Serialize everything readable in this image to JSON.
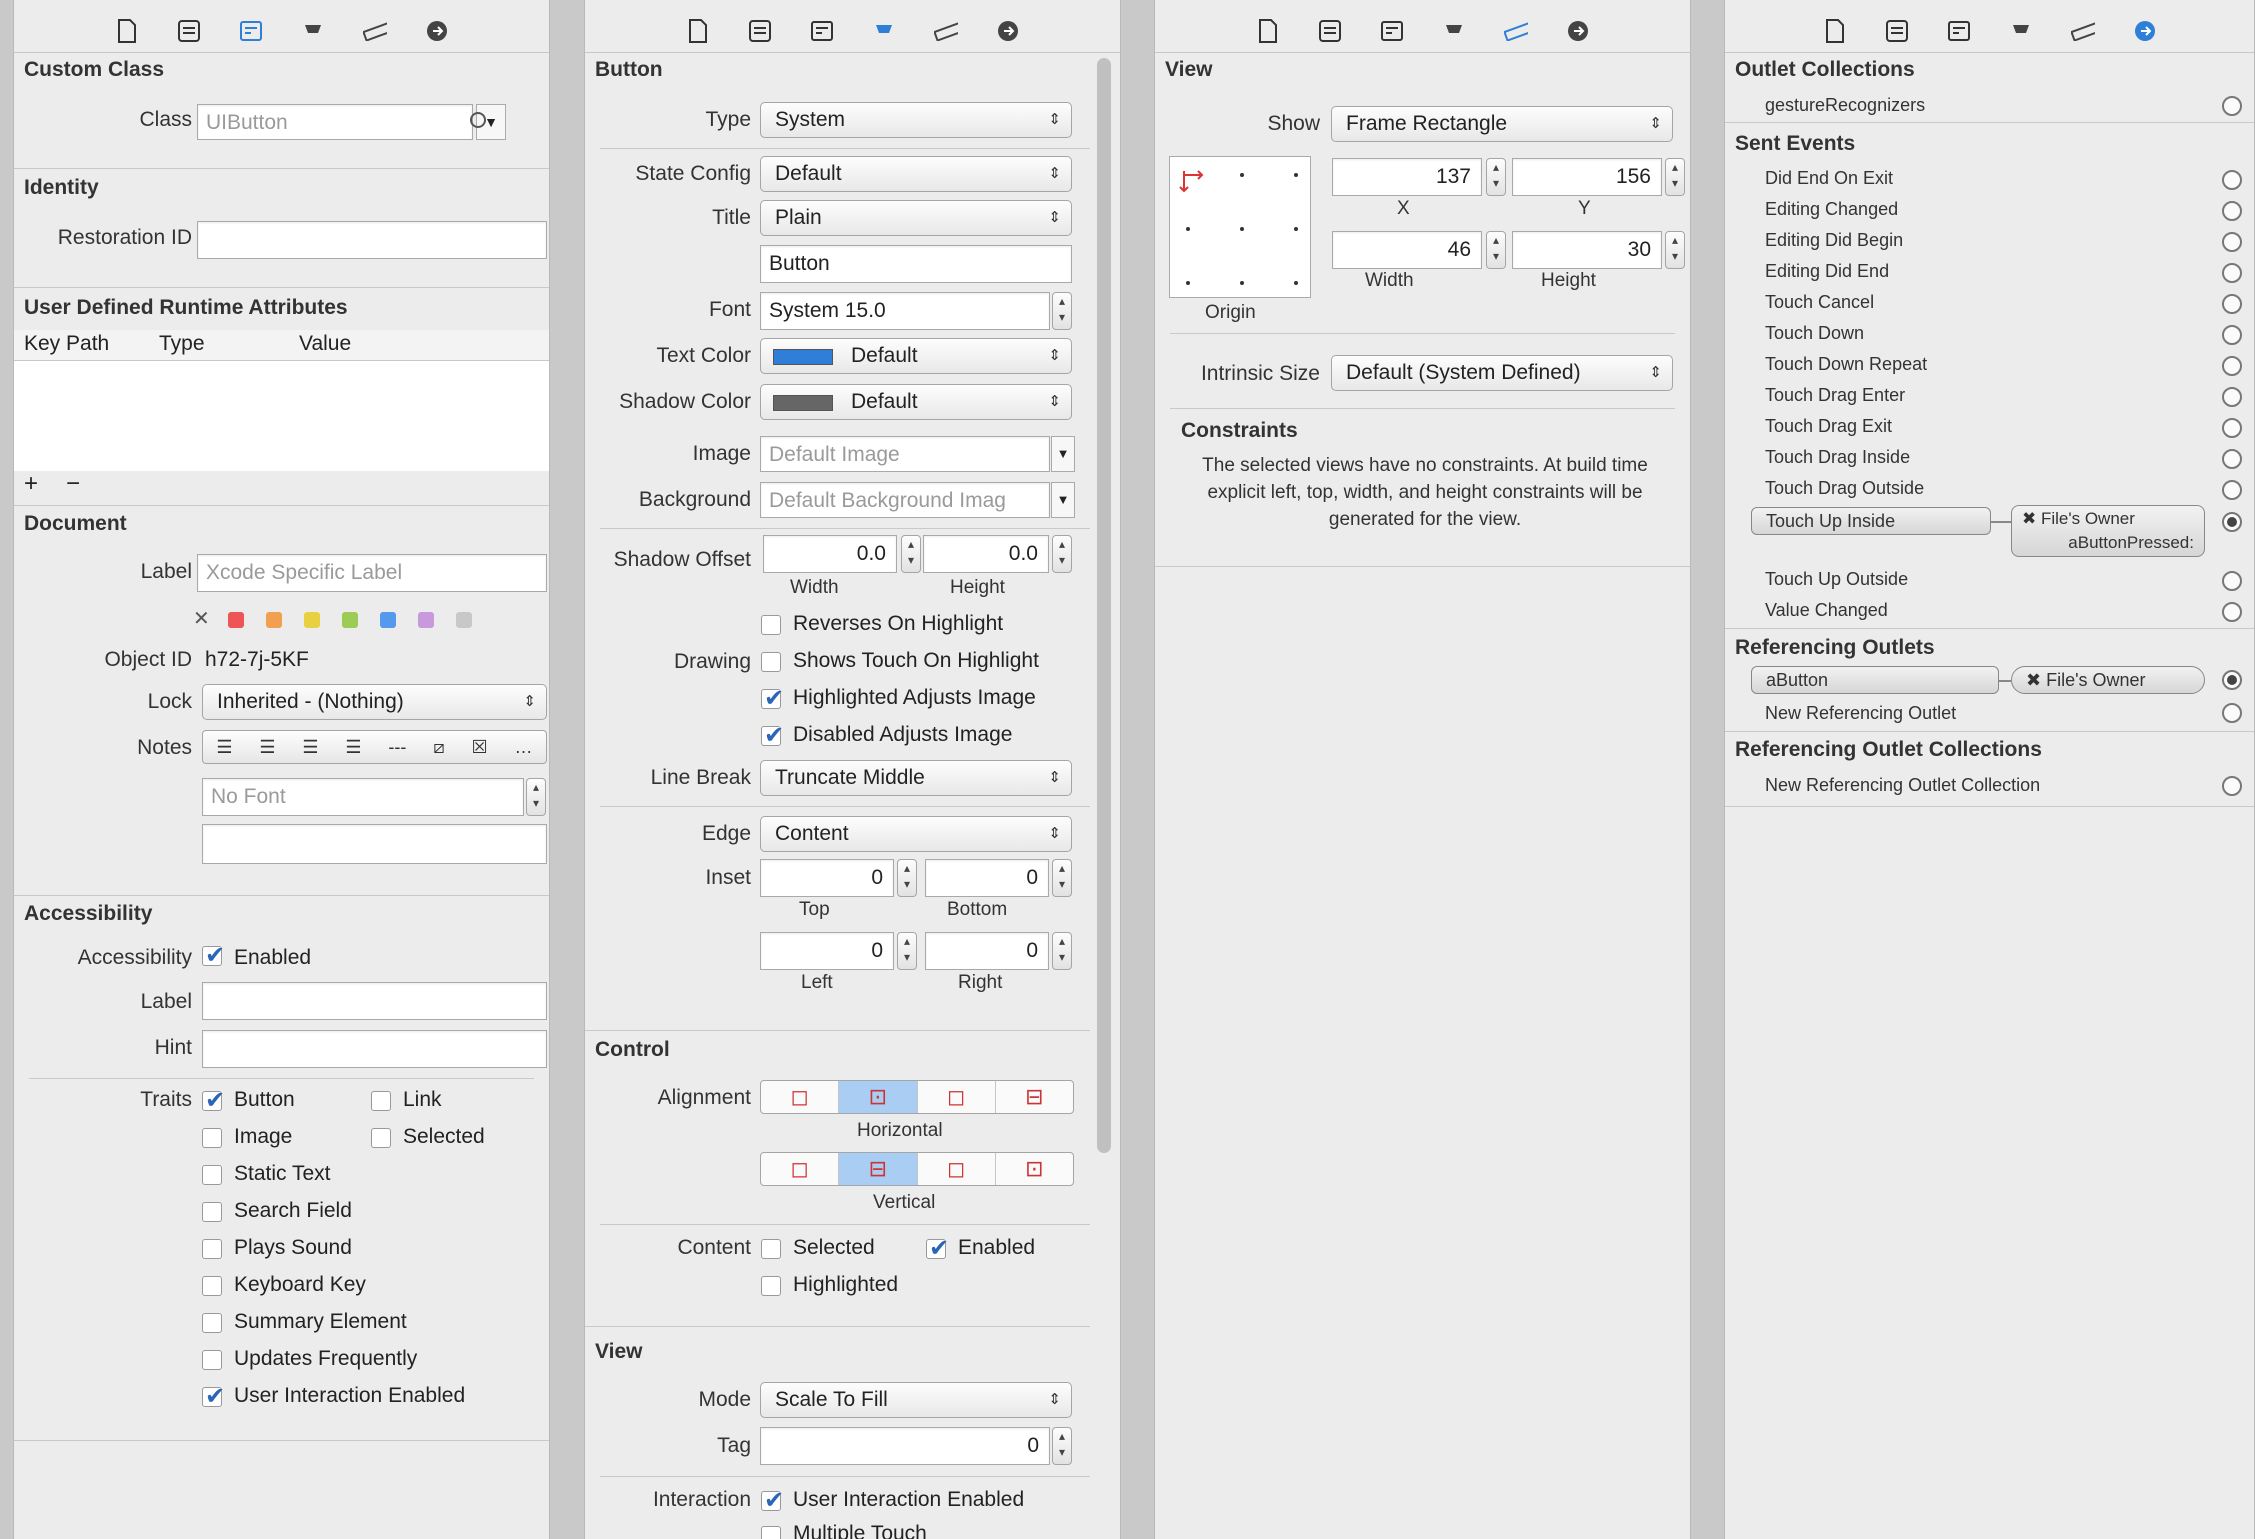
{
  "tabs_icons": [
    "file-icon",
    "quick-help-icon",
    "identity-icon",
    "attributes-icon",
    "size-icon",
    "connections-icon"
  ],
  "identity": {
    "custom_class": {
      "header": "Custom Class",
      "class_label": "Class",
      "class_placeholder": "UIButton"
    },
    "identity": {
      "header": "Identity",
      "restoration_label": "Restoration ID"
    },
    "udra": {
      "header": "User Defined Runtime Attributes",
      "col_keypath": "Key Path",
      "col_type": "Type",
      "col_value": "Value",
      "add": "+",
      "remove": "−"
    },
    "document": {
      "header": "Document",
      "label_label": "Label",
      "label_placeholder": "Xcode Specific Label",
      "object_id_label": "Object ID",
      "object_id": "h72-7j-5KF",
      "lock_label": "Lock",
      "lock_value": "Inherited - (Nothing)",
      "notes_label": "Notes",
      "font_placeholder": "No Font",
      "label_colors": [
        "#e55",
        "#f0a050",
        "#e8d040",
        "#9ccc55",
        "#5599ee",
        "#c899dd",
        "#c8c8c8"
      ]
    },
    "accessibility": {
      "header": "Accessibility",
      "accessibility_label": "Accessibility",
      "enabled": "Enabled",
      "label_label": "Label",
      "hint_label": "Hint",
      "traits_label": "Traits",
      "traits": [
        {
          "label": "Button",
          "checked": true
        },
        {
          "label": "Link",
          "checked": false
        },
        {
          "label": "Image",
          "checked": false
        },
        {
          "label": "Selected",
          "checked": false
        },
        {
          "label": "Static Text",
          "checked": false
        },
        {
          "label": "Search Field",
          "checked": false
        },
        {
          "label": "Plays Sound",
          "checked": false
        },
        {
          "label": "Keyboard Key",
          "checked": false
        },
        {
          "label": "Summary Element",
          "checked": false
        },
        {
          "label": "Updates Frequently",
          "checked": false
        },
        {
          "label": "User Interaction Enabled",
          "checked": true
        }
      ]
    }
  },
  "attributes": {
    "button": {
      "header": "Button",
      "type_label": "Type",
      "type": "System",
      "state_label": "State Config",
      "state": "Default",
      "title_label": "Title",
      "title_kind": "Plain",
      "title_text": "Button",
      "font_label": "Font",
      "font": "System 15.0",
      "text_color_label": "Text Color",
      "text_color": "Default",
      "text_color_swatch": "#2f7fd8",
      "shadow_color_label": "Shadow Color",
      "shadow_color": "Default",
      "shadow_swatch": "#666666",
      "image_label": "Image",
      "image_placeholder": "Default Image",
      "background_label": "Background",
      "background_placeholder": "Default Background Imag",
      "shadow_offset_label": "Shadow Offset",
      "shadow_w": "0.0",
      "shadow_h": "0.0",
      "width_caption": "Width",
      "height_caption": "Height",
      "drawing_label": "Drawing",
      "reverses": "Reverses On Highlight",
      "shows_touch": "Shows Touch On Highlight",
      "highlighted_adjusts": "Highlighted Adjusts Image",
      "disabled_adjusts": "Disabled Adjusts Image",
      "line_break_label": "Line Break",
      "line_break": "Truncate Middle",
      "edge_label": "Edge",
      "edge": "Content",
      "inset_label": "Inset",
      "inset_top": "0",
      "inset_bottom": "0",
      "inset_left": "0",
      "inset_right": "0",
      "top_caption": "Top",
      "bottom_caption": "Bottom",
      "left_caption": "Left",
      "right_caption": "Right"
    },
    "control": {
      "header": "Control",
      "alignment_label": "Alignment",
      "horizontal": "Horizontal",
      "vertical": "Vertical",
      "content_label": "Content",
      "selected": "Selected",
      "enabled": "Enabled",
      "highlighted": "Highlighted"
    },
    "view": {
      "header": "View",
      "mode_label": "Mode",
      "mode": "Scale To Fill",
      "tag_label": "Tag",
      "tag": "0",
      "interaction_label": "Interaction",
      "user_interaction": "User Interaction Enabled",
      "multiple_touch": "Multiple Touch"
    }
  },
  "size": {
    "header": "View",
    "show_label": "Show",
    "show": "Frame Rectangle",
    "x": "137",
    "y": "156",
    "width": "46",
    "height": "30",
    "x_caption": "X",
    "y_caption": "Y",
    "width_caption": "Width",
    "height_caption": "Height",
    "origin_caption": "Origin",
    "intrinsic_label": "Intrinsic Size",
    "intrinsic": "Default (System Defined)",
    "constraints_header": "Constraints",
    "constraints_text": "The selected views have no constraints. At build time explicit left, top, width, and height constraints will be generated for the view."
  },
  "connections": {
    "outlet_collections_header": "Outlet Collections",
    "outlet_collections": [
      "gestureRecognizers"
    ],
    "sent_events_header": "Sent Events",
    "sent_events": [
      "Did End On Exit",
      "Editing Changed",
      "Editing Did Begin",
      "Editing Did End",
      "Touch Cancel",
      "Touch Down",
      "Touch Down Repeat",
      "Touch Drag Enter",
      "Touch Drag Exit",
      "Touch Drag Inside",
      "Touch Drag Outside",
      "Touch Up Inside",
      "Touch Up Outside",
      "Value Changed"
    ],
    "touch_up_inside_target": "File's Owner",
    "touch_up_inside_action": "aButtonPressed:",
    "referencing_outlets_header": "Referencing Outlets",
    "outlet_name": "aButton",
    "outlet_target": "File's Owner",
    "new_ref_outlet": "New Referencing Outlet",
    "ref_outlet_collections_header": "Referencing Outlet Collections",
    "new_ref_outlet_collection": "New Referencing Outlet Collection"
  }
}
